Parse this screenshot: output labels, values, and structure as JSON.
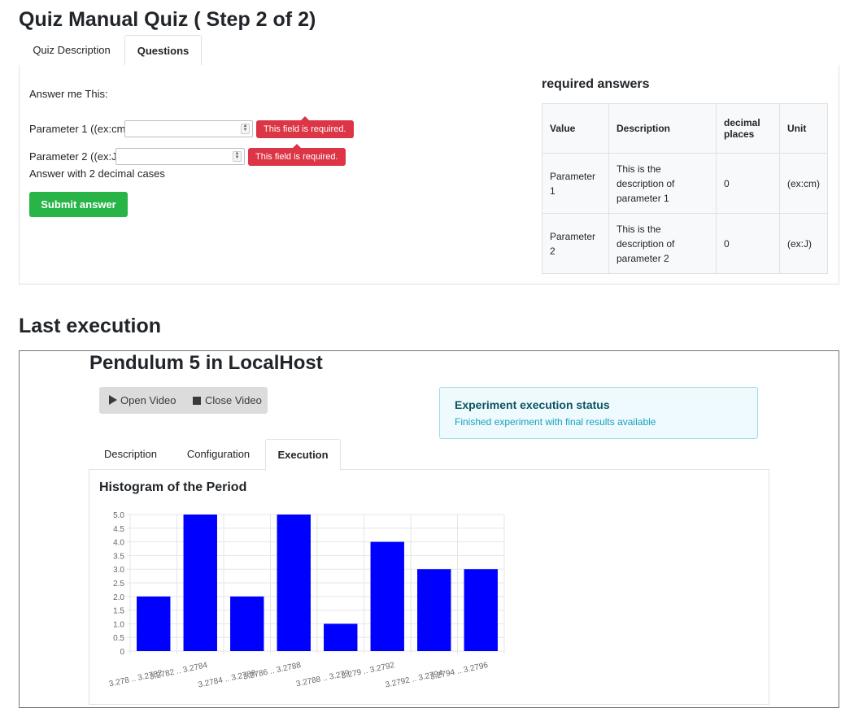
{
  "quiz": {
    "title": "Quiz Manual Quiz ( Step 2 of 2)",
    "tabs": [
      "Quiz Description",
      "Questions"
    ],
    "active_tab": "Questions",
    "question_text": "Answer me This:",
    "param1_label": "Parameter 1 ((ex:cm))",
    "param1_value": "",
    "param1_error": "This field is required.",
    "param2_label": "Parameter 2 ((ex:J))",
    "param2_value": "",
    "param2_error": "This field is required.",
    "hint": "Answer with 2 decimal cases",
    "submit_label": "Submit answer"
  },
  "required_answers": {
    "heading": "required answers",
    "columns": [
      "Value",
      "Description",
      "decimal places",
      "Unit"
    ],
    "rows": [
      {
        "value": "Parameter 1",
        "description": "This is the description of parameter 1",
        "decimals": "0",
        "unit": "(ex:cm)"
      },
      {
        "value": "Parameter 2",
        "description": "This is the description of parameter 2",
        "decimals": "0",
        "unit": "(ex:J)"
      }
    ]
  },
  "last_execution": {
    "section_title": "Last execution",
    "experiment_title": "Pendulum 5 in LocalHost",
    "open_video_label": "Open Video",
    "close_video_label": "Close Video",
    "status_title": "Experiment execution status",
    "status_message": "Finished experiment with final results available",
    "tabs": [
      "Description",
      "Configuration",
      "Execution"
    ],
    "active_tab": "Execution",
    "histogram_title": "Histogram of the Period"
  },
  "colors": {
    "bar": "#0000ff",
    "error": "#dc3545",
    "submit": "#28b446"
  },
  "chart_data": {
    "type": "bar",
    "title": "Histogram of the Period",
    "categories": [
      "3.278 .. 3.2782",
      "3.2782 .. 3.2784",
      "3.2784 .. 3.2786",
      "3.2786 .. 3.2788",
      "3.2788 .. 3.279",
      "3.279 .. 3.2792",
      "3.2792 .. 3.2794",
      "3.2794 .. 3.2796"
    ],
    "values": [
      2,
      5,
      2,
      5,
      1,
      4,
      3,
      3
    ],
    "ylim": [
      0,
      5
    ],
    "yticks": [
      "0",
      "0.5",
      "1.0",
      "1.5",
      "2.0",
      "2.5",
      "3.0",
      "3.5",
      "4.0",
      "4.5",
      "5.0"
    ],
    "grid": true
  }
}
